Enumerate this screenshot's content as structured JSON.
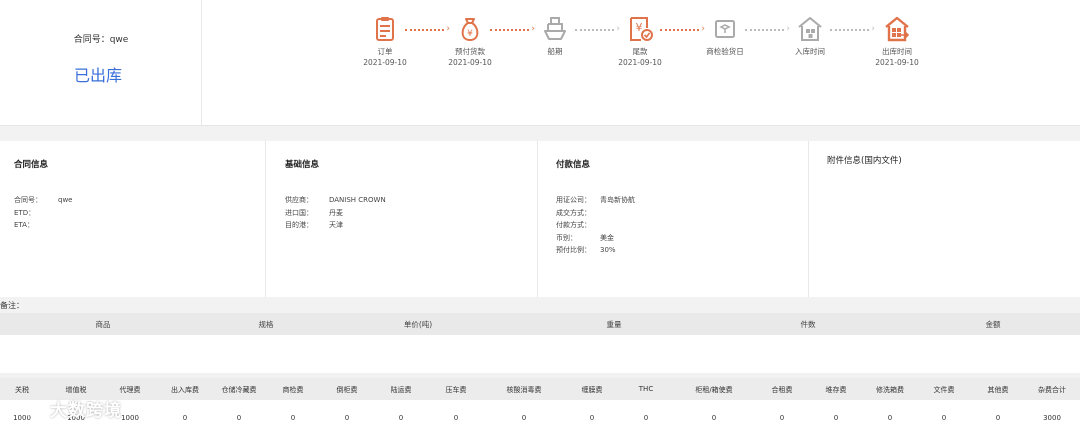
{
  "contract": {
    "number_label": "合同号：qwe",
    "status": "已出库"
  },
  "steps": [
    {
      "name": "订单",
      "date": "2021-09-10",
      "icon": "order-clipboard-icon",
      "active": true
    },
    {
      "name": "预付货款",
      "date": "2021-09-10",
      "icon": "money-bag-icon",
      "active": true
    },
    {
      "name": "船期",
      "date": "",
      "icon": "ship-icon",
      "active": false
    },
    {
      "name": "尾款",
      "date": "2021-09-10",
      "icon": "yuan-receipt-check-icon",
      "active": true
    },
    {
      "name": "商检验货日",
      "date": "",
      "icon": "inspection-box-icon",
      "active": false
    },
    {
      "name": "入库时间",
      "date": "",
      "icon": "warehouse-in-icon",
      "active": false
    },
    {
      "name": "出库时间",
      "date": "2021-09-10",
      "icon": "warehouse-out-icon",
      "active": true
    }
  ],
  "panels": {
    "contract_info": {
      "title": "合同信息",
      "rows": [
        {
          "k": "合同号：",
          "v": "qwe"
        },
        {
          "k": "ETD：",
          "v": ""
        },
        {
          "k": "ETA：",
          "v": ""
        }
      ]
    },
    "basic_info": {
      "title": "基础信息",
      "rows": [
        {
          "k": "供应商：",
          "v": "DANISH CROWN"
        },
        {
          "k": "进口国：",
          "v": "丹麦"
        },
        {
          "k": "目的港：",
          "v": "天津"
        }
      ]
    },
    "payment_info": {
      "title": "付款信息",
      "rows": [
        {
          "k": "用证公司：",
          "v": "青岛新协航"
        },
        {
          "k": "成交方式：",
          "v": ""
        },
        {
          "k": "付款方式：",
          "v": ""
        },
        {
          "k": "币别：",
          "v": "美金"
        },
        {
          "k": "预付比例：",
          "v": "30%"
        }
      ]
    },
    "attachment_info": {
      "title": "附件信息(国内文件)"
    }
  },
  "remark_label": "备注：",
  "product_table": {
    "headers": [
      "商品",
      "规格",
      "单价(吨)",
      "重量",
      "件数",
      "金额"
    ]
  },
  "fee_table": {
    "headers": [
      "关税",
      "增值税",
      "代理费",
      "出入库费",
      "仓储冷藏费",
      "商检费",
      "倒柜费",
      "陆运费",
      "压车费",
      "核酸消毒费",
      "缠膜费",
      "THC",
      "柜租/箱使费",
      "合租费",
      "堆存费",
      "修洗箱费",
      "文件费",
      "其他费",
      "杂费合计"
    ],
    "values": [
      "1000",
      "1000",
      "1000",
      "0",
      "0",
      "0",
      "0",
      "0",
      "0",
      "0",
      "0",
      "0",
      "0",
      "0",
      "0",
      "0",
      "0",
      "0",
      "3000"
    ]
  },
  "watermark": "大数跨境",
  "colors": {
    "accent_orange": "#e0734a",
    "inactive_grey": "#aaaaaa",
    "status_blue": "#3a6fd8"
  }
}
